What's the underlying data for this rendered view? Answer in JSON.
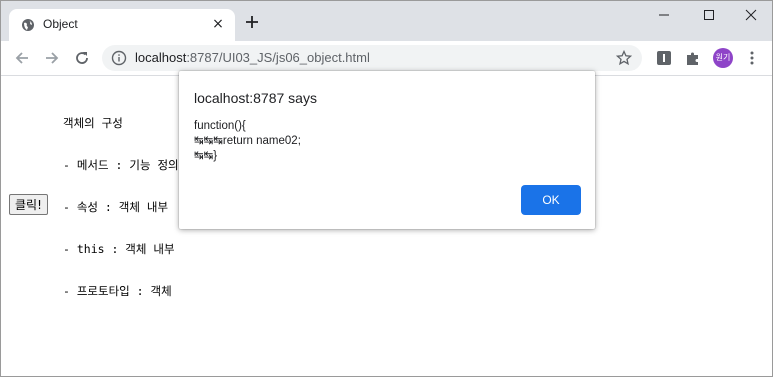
{
  "browser": {
    "tab": {
      "title": "Object",
      "favicon": "globe-icon"
    },
    "new_tab_glyph": "+",
    "close_glyph": "×",
    "address": {
      "host": "localhost",
      "path": ":8787/UI03_JS/js06_object.html"
    },
    "profile_initials": "원기"
  },
  "page": {
    "lines": [
      "객체의 구성",
      "- 메서드 : 기능 정의",
      "- 속성 : 객체 내부",
      "- this : 객체 내부",
      "- 프로토타입 : 객체"
    ],
    "button_label": "클릭!"
  },
  "dialog": {
    "title": "localhost:8787 says",
    "message_lines": [
      "function(){",
      "↹↹↹return name02;",
      "↹↹}"
    ],
    "ok_label": "OK"
  },
  "colors": {
    "accent": "#1a73e8",
    "tabstrip": "#dee1e6",
    "profile": "#8e44c8"
  }
}
